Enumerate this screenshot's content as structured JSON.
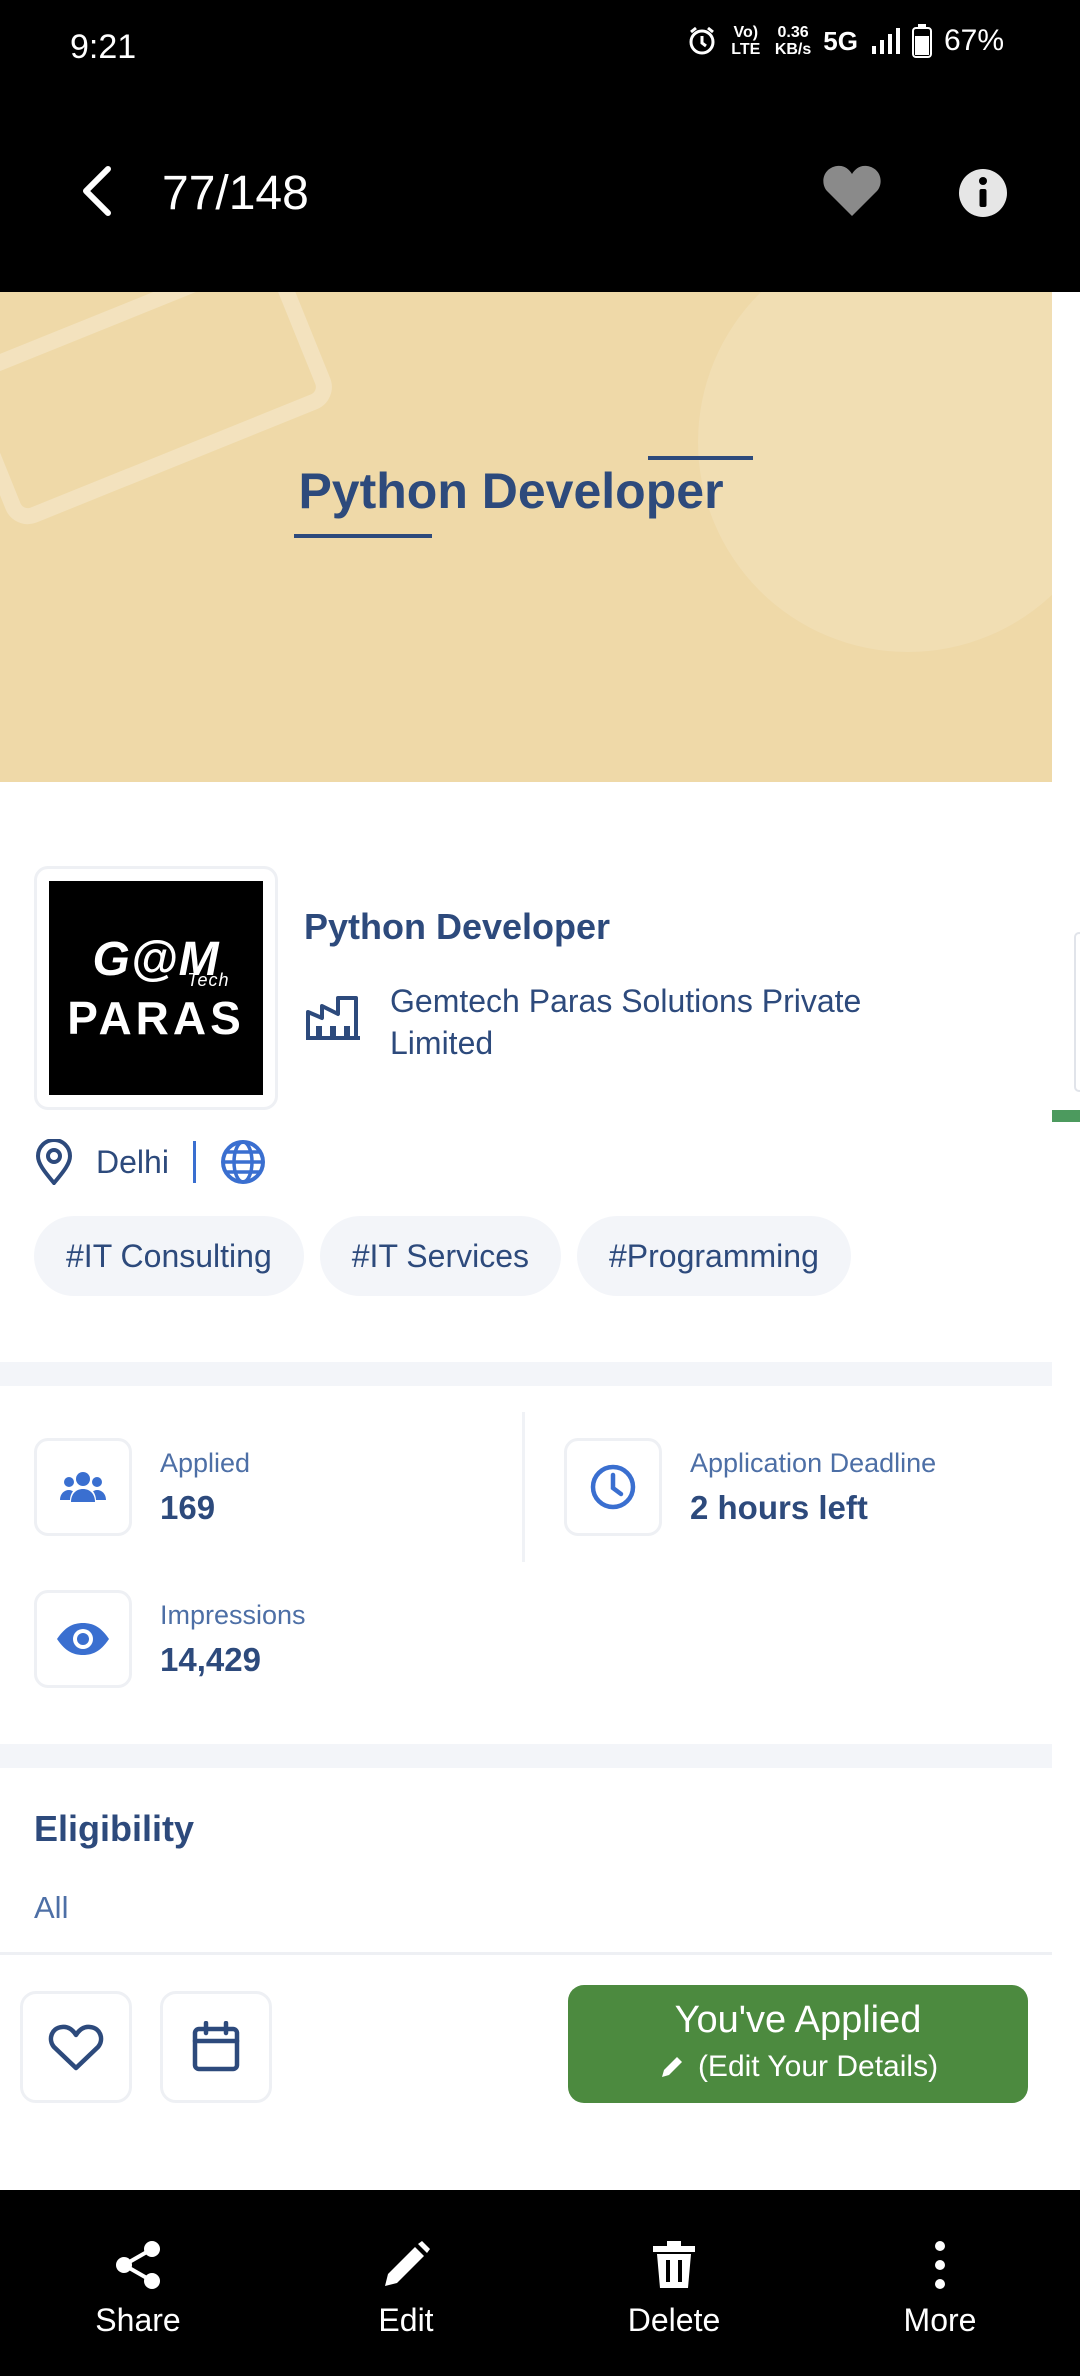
{
  "status_bar": {
    "time": "9:21",
    "net_volte": "Vo) LTE",
    "net_speed_value": "0.36",
    "net_speed_unit": "KB/s",
    "network": "5G",
    "battery": "67%"
  },
  "top_bar": {
    "counter": "77/148"
  },
  "banner": {
    "title": "Python Developer"
  },
  "job": {
    "title": "Python Developer",
    "company": "Gemtech Paras Solutions Private Limited",
    "location": "Delhi",
    "logo_line1": "G@M",
    "logo_tech": "Tech",
    "logo_line2": "PARAS",
    "tags": [
      "#IT Consulting",
      "#IT Services",
      "#Programming"
    ]
  },
  "stats": {
    "applied_label": "Applied",
    "applied_value": "169",
    "deadline_label": "Application Deadline",
    "deadline_value": "2 hours left",
    "impressions_label": "Impressions",
    "impressions_value": "14,429"
  },
  "eligibility": {
    "title": "Eligibility",
    "value": "All"
  },
  "actions": {
    "applied_title": "You've Applied",
    "applied_sub": "(Edit Your Details)"
  },
  "bottom_nav": {
    "share": "Share",
    "edit": "Edit",
    "delete": "Delete",
    "more": "More"
  },
  "colors": {
    "primary_text": "#2d4a7c",
    "banner_bg": "#efd9a8",
    "applied_green": "#4c8a3f",
    "accent_blue": "#3a6fd0"
  }
}
